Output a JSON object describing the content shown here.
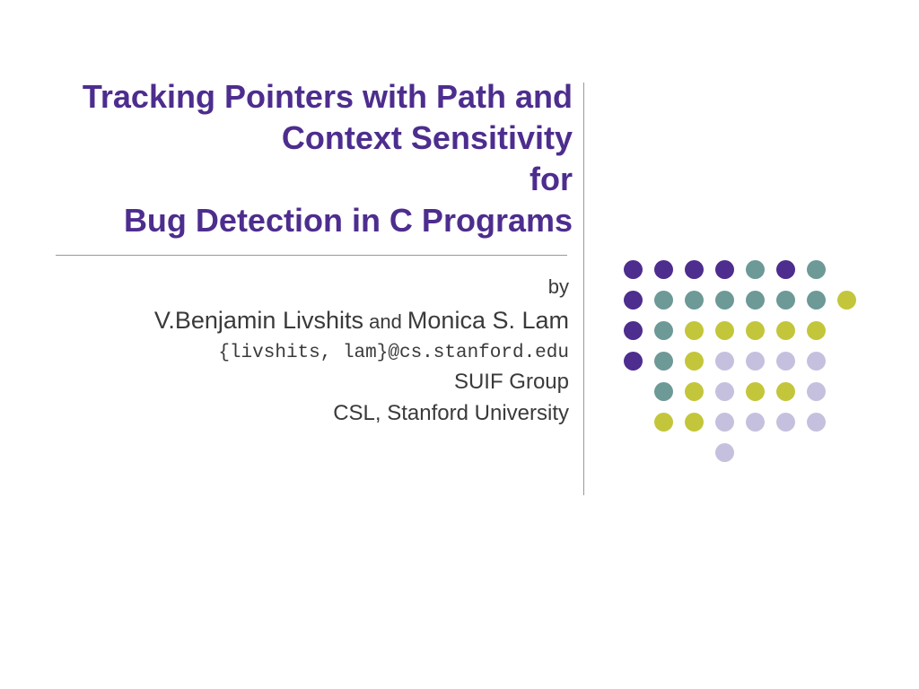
{
  "title": {
    "line1": "Tracking Pointers with Path and",
    "line2": "Context Sensitivity",
    "line3": "for",
    "line4": "Bug Detection in C Programs"
  },
  "author": {
    "by": "by",
    "name1": "V.Benjamin Livshits",
    "connector": " and ",
    "name2": "Monica S. Lam",
    "email": "{livshits, lam}@cs.stanford.edu",
    "group": "SUIF Group",
    "affiliation": "CSL, Stanford University"
  }
}
